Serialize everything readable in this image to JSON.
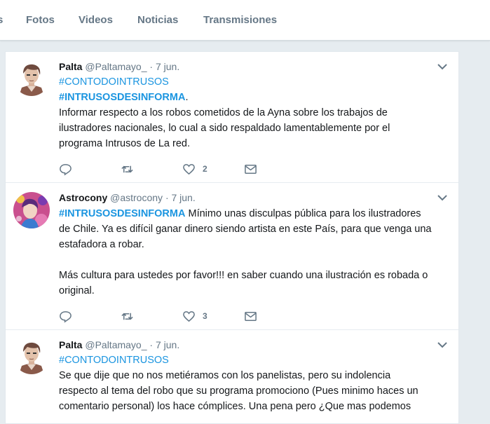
{
  "nav": {
    "tabs": [
      {
        "label": "s"
      },
      {
        "label": "Fotos"
      },
      {
        "label": "Videos"
      },
      {
        "label": "Noticias"
      },
      {
        "label": "Transmisiones"
      }
    ]
  },
  "tweets": [
    {
      "name": "Palta",
      "handle": "@Paltamayo_",
      "date": "· 7 jun.",
      "lines": [
        {
          "parts": [
            {
              "t": "#CONTODOINTRUSOS"
            }
          ]
        },
        {
          "parts": [
            {
              "t": "#INTRUSOSDESINFORMA"
            },
            {
              "t": "."
            }
          ]
        },
        {
          "parts": [
            {
              "t": "Informar respecto a los robos cometidos de la Ayna sobre los trabajos de"
            }
          ]
        },
        {
          "parts": [
            {
              "t": "ilustradores nacionales, lo cual a sido respaldado lamentablemente por el"
            }
          ]
        },
        {
          "parts": [
            {
              "t": "programa Intrusos de La red."
            }
          ]
        }
      ],
      "likes": "2"
    },
    {
      "name": "Astrocony",
      "handle": "@astrocony",
      "date": "· 7 jun.",
      "lines": [
        {
          "parts": [
            {
              "t": "#INTRUSOSDESINFORMA"
            },
            {
              "t": " Mínimo unas disculpas pública para los ilustradores"
            }
          ]
        },
        {
          "parts": [
            {
              "t": "de Chile. Ya es difícil ganar dinero siendo artista en este País, para que venga una"
            }
          ]
        },
        {
          "parts": [
            {
              "t": "estafadora a robar."
            }
          ]
        },
        {
          "parts": [
            {
              "t": "Más cultura para ustedes por favor!!! en saber cuando una ilustración es robada o"
            }
          ]
        },
        {
          "parts": [
            {
              "t": "original."
            }
          ]
        }
      ],
      "likes": "3"
    },
    {
      "name": "Palta",
      "handle": "@Paltamayo_",
      "date": "· 7 jun.",
      "lines": [
        {
          "parts": [
            {
              "t": "#CONTODOINTRUSOS"
            }
          ]
        },
        {
          "parts": [
            {
              "t": "Se que dije que no nos metiéramos con los panelistas, pero su indolencia"
            }
          ]
        },
        {
          "parts": [
            {
              "t": "respecto al tema del robo que su programa promociono  (Pues minimo haces un"
            }
          ]
        },
        {
          "parts": [
            {
              "t": "comentario personal) los hace cómplices. Una pena pero ¿Que mas podemos"
            }
          ]
        }
      ]
    }
  ],
  "colors": {
    "link": "#1b95e0",
    "muted": "#657786",
    "text": "#14171a",
    "background": "#e6ecf0"
  },
  "icons": [
    "reply-icon",
    "retweet-icon",
    "like-icon",
    "message-icon",
    "chevron-down-icon"
  ]
}
